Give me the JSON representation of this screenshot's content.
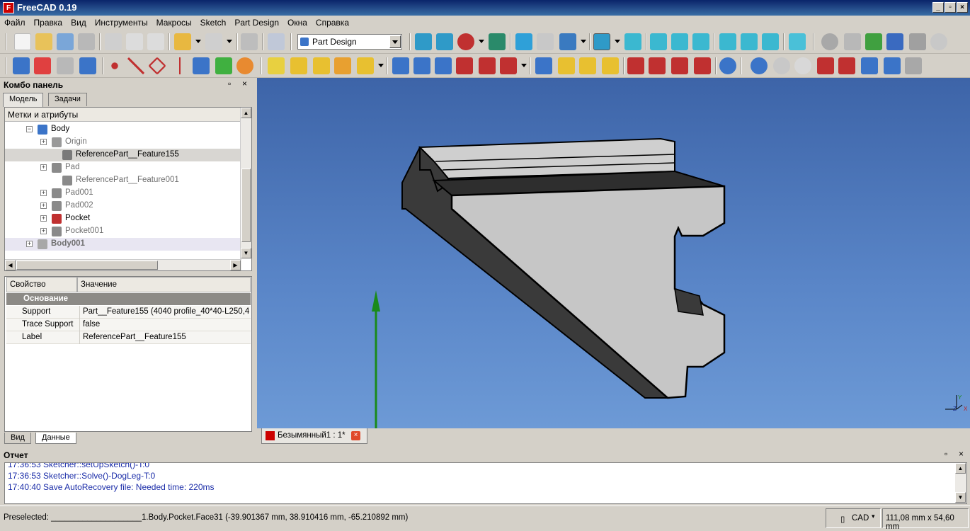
{
  "window": {
    "title": "FreeCAD 0.19",
    "app_icon_letter": "F",
    "controls": [
      "_",
      "▫",
      "×"
    ]
  },
  "menu": [
    "Файл",
    "Правка",
    "Вид",
    "Инструменты",
    "Макросы",
    "Sketch",
    "Part Design",
    "Окна",
    "Справка"
  ],
  "workbench": {
    "selected": "Part Design"
  },
  "combo": {
    "title": "Комбо панель",
    "tabs": [
      "Модель",
      "Задачи"
    ],
    "tree_header": "Метки и атрибуты",
    "tree": [
      {
        "label": "Body",
        "expander": "−",
        "color": "#3b74c8",
        "bold": false,
        "dim": false
      },
      {
        "label": "Origin",
        "expander": "+",
        "color": "#999999",
        "bold": false,
        "dim": true
      },
      {
        "label": "ReferencePart__Feature155",
        "expander": "",
        "color": "#7a7a7a",
        "bold": false,
        "dim": false,
        "selected": true
      },
      {
        "label": "Pad",
        "expander": "+",
        "color": "#8a8a8a",
        "bold": false,
        "dim": true
      },
      {
        "label": "ReferencePart__Feature001",
        "expander": "",
        "color": "#8a8a8a",
        "bold": false,
        "dim": true
      },
      {
        "label": "Pad001",
        "expander": "+",
        "color": "#8a8a8a",
        "bold": false,
        "dim": true
      },
      {
        "label": "Pad002",
        "expander": "+",
        "color": "#8a8a8a",
        "bold": false,
        "dim": true
      },
      {
        "label": "Pocket",
        "expander": "+",
        "color": "#c03030",
        "bold": false,
        "dim": false
      },
      {
        "label": "Pocket001",
        "expander": "+",
        "color": "#8a8a8a",
        "bold": false,
        "dim": true
      },
      {
        "label": "Body001",
        "expander": "+",
        "color": "#a8a8a8",
        "bold": true,
        "dim": true
      }
    ],
    "props": {
      "col_property": "Свойство",
      "col_value": "Значение",
      "group": "Основание",
      "rows": [
        {
          "key": "Support",
          "value": "Part__Feature155 (4040 profile_40*40-L250,4..."
        },
        {
          "key": "Trace Support",
          "value": "false"
        },
        {
          "key": "Label",
          "value": "ReferencePart__Feature155"
        }
      ]
    },
    "bottom_tabs": [
      "Вид",
      "Данные"
    ]
  },
  "document_tab": {
    "label": "Безымянный1 : 1*",
    "close": "×"
  },
  "report": {
    "title": "Отчет",
    "lines": [
      "17:36:53  Sketcher::setUpSketch()-T:0",
      "17:36:53  Sketcher::Solve()-DogLeg-T:0",
      "17:40:40  Save AutoRecovery file: Needed time: 220ms"
    ]
  },
  "status": {
    "preselected": "Preselected: ____________________1.Body.Pocket.Face31 (-39.901367 mm, 38.910416 mm, -65.210892 mm)",
    "nav_style": "CAD",
    "dimensions": "111,08 mm x 54,60 mm"
  },
  "axis": {
    "x": "X",
    "y": "Y",
    "z": "Z"
  },
  "colors": {
    "viewport_top": "#3d64a8",
    "viewport_bottom": "#6d9ad6",
    "part_light": "#c8c8c8",
    "part_dark": "#3a3a3a",
    "axis_green": "#1a8a1a",
    "log_text": "#1a2ca8"
  }
}
